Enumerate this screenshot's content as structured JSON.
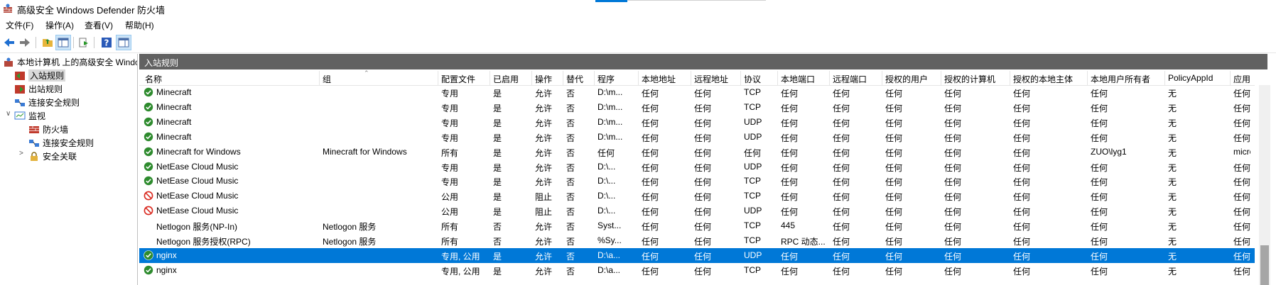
{
  "window": {
    "title": "高级安全 Windows Defender 防火墙"
  },
  "menu": [
    "文件(F)",
    "操作(A)",
    "查看(V)",
    "帮助(H)"
  ],
  "tree": {
    "root": "本地计算机 上的高级安全 Windo",
    "inbound": "入站规则",
    "outbound": "出站规则",
    "consec": "连接安全规则",
    "monitor": "监视",
    "firewall": "防火墙",
    "mon_consec": "连接安全规则",
    "sa": "安全关联"
  },
  "panel": {
    "title": "入站规则"
  },
  "columns": [
    "名称",
    "组",
    "配置文件",
    "已启用",
    "操作",
    "替代",
    "程序",
    "本地地址",
    "远程地址",
    "协议",
    "本地端口",
    "远程端口",
    "授权的用户",
    "授权的计算机",
    "授权的本地主体",
    "本地用户所有者",
    "PolicyAppId",
    "应用程"
  ],
  "rows": [
    {
      "status": "allow",
      "name": "Minecraft",
      "group": "",
      "profile": "专用",
      "enabled": "是",
      "action": "允许",
      "override": "否",
      "program": "D:\\m...",
      "laddr": "任何",
      "raddr": "任何",
      "proto": "TCP",
      "lport": "任何",
      "rport": "任何",
      "users": "任何",
      "computers": "任何",
      "principals": "任何",
      "owner": "任何",
      "policy": "无",
      "app": "任何"
    },
    {
      "status": "allow",
      "name": "Minecraft",
      "group": "",
      "profile": "专用",
      "enabled": "是",
      "action": "允许",
      "override": "否",
      "program": "D:\\m...",
      "laddr": "任何",
      "raddr": "任何",
      "proto": "TCP",
      "lport": "任何",
      "rport": "任何",
      "users": "任何",
      "computers": "任何",
      "principals": "任何",
      "owner": "任何",
      "policy": "无",
      "app": "任何"
    },
    {
      "status": "allow",
      "name": "Minecraft",
      "group": "",
      "profile": "专用",
      "enabled": "是",
      "action": "允许",
      "override": "否",
      "program": "D:\\m...",
      "laddr": "任何",
      "raddr": "任何",
      "proto": "UDP",
      "lport": "任何",
      "rport": "任何",
      "users": "任何",
      "computers": "任何",
      "principals": "任何",
      "owner": "任何",
      "policy": "无",
      "app": "任何"
    },
    {
      "status": "allow",
      "name": "Minecraft",
      "group": "",
      "profile": "专用",
      "enabled": "是",
      "action": "允许",
      "override": "否",
      "program": "D:\\m...",
      "laddr": "任何",
      "raddr": "任何",
      "proto": "UDP",
      "lport": "任何",
      "rport": "任何",
      "users": "任何",
      "computers": "任何",
      "principals": "任何",
      "owner": "任何",
      "policy": "无",
      "app": "任何"
    },
    {
      "status": "allow",
      "name": "Minecraft for Windows",
      "group": "Minecraft for Windows",
      "profile": "所有",
      "enabled": "是",
      "action": "允许",
      "override": "否",
      "program": "任何",
      "laddr": "任何",
      "raddr": "任何",
      "proto": "任何",
      "lport": "任何",
      "rport": "任何",
      "users": "任何",
      "computers": "任何",
      "principals": "任何",
      "owner": "ZUO\\lyg1",
      "policy": "无",
      "app": "micro"
    },
    {
      "status": "allow",
      "name": "NetEase Cloud Music",
      "group": "",
      "profile": "专用",
      "enabled": "是",
      "action": "允许",
      "override": "否",
      "program": "D:\\...",
      "laddr": "任何",
      "raddr": "任何",
      "proto": "UDP",
      "lport": "任何",
      "rport": "任何",
      "users": "任何",
      "computers": "任何",
      "principals": "任何",
      "owner": "任何",
      "policy": "无",
      "app": "任何"
    },
    {
      "status": "allow",
      "name": "NetEase Cloud Music",
      "group": "",
      "profile": "专用",
      "enabled": "是",
      "action": "允许",
      "override": "否",
      "program": "D:\\...",
      "laddr": "任何",
      "raddr": "任何",
      "proto": "TCP",
      "lport": "任何",
      "rport": "任何",
      "users": "任何",
      "computers": "任何",
      "principals": "任何",
      "owner": "任何",
      "policy": "无",
      "app": "任何"
    },
    {
      "status": "block",
      "name": "NetEase Cloud Music",
      "group": "",
      "profile": "公用",
      "enabled": "是",
      "action": "阻止",
      "override": "否",
      "program": "D:\\...",
      "laddr": "任何",
      "raddr": "任何",
      "proto": "TCP",
      "lport": "任何",
      "rport": "任何",
      "users": "任何",
      "computers": "任何",
      "principals": "任何",
      "owner": "任何",
      "policy": "无",
      "app": "任何"
    },
    {
      "status": "block",
      "name": "NetEase Cloud Music",
      "group": "",
      "profile": "公用",
      "enabled": "是",
      "action": "阻止",
      "override": "否",
      "program": "D:\\...",
      "laddr": "任何",
      "raddr": "任何",
      "proto": "UDP",
      "lport": "任何",
      "rport": "任何",
      "users": "任何",
      "computers": "任何",
      "principals": "任何",
      "owner": "任何",
      "policy": "无",
      "app": "任何"
    },
    {
      "status": "none",
      "name": "Netlogon 服务(NP-In)",
      "group": "Netlogon 服务",
      "profile": "所有",
      "enabled": "否",
      "action": "允许",
      "override": "否",
      "program": "Syst...",
      "laddr": "任何",
      "raddr": "任何",
      "proto": "TCP",
      "lport": "445",
      "rport": "任何",
      "users": "任何",
      "computers": "任何",
      "principals": "任何",
      "owner": "任何",
      "policy": "无",
      "app": "任何"
    },
    {
      "status": "none",
      "name": "Netlogon 服务授权(RPC)",
      "group": "Netlogon 服务",
      "profile": "所有",
      "enabled": "否",
      "action": "允许",
      "override": "否",
      "program": "%Sy...",
      "laddr": "任何",
      "raddr": "任何",
      "proto": "TCP",
      "lport": "RPC 动态...",
      "rport": "任何",
      "users": "任何",
      "computers": "任何",
      "principals": "任何",
      "owner": "任何",
      "policy": "无",
      "app": "任何"
    },
    {
      "status": "allow",
      "name": "nginx",
      "group": "",
      "profile": "专用, 公用",
      "enabled": "是",
      "action": "允许",
      "override": "否",
      "program": "D:\\a...",
      "laddr": "任何",
      "raddr": "任何",
      "proto": "UDP",
      "lport": "任何",
      "rport": "任何",
      "users": "任何",
      "computers": "任何",
      "principals": "任何",
      "owner": "任何",
      "policy": "无",
      "app": "任何",
      "selected": true
    },
    {
      "status": "allow",
      "name": "nginx",
      "group": "",
      "profile": "专用, 公用",
      "enabled": "是",
      "action": "允许",
      "override": "否",
      "program": "D:\\a...",
      "laddr": "任何",
      "raddr": "任何",
      "proto": "TCP",
      "lport": "任何",
      "rport": "任何",
      "users": "任何",
      "computers": "任何",
      "principals": "任何",
      "owner": "任何",
      "policy": "无",
      "app": "任何"
    }
  ],
  "colors": {
    "accent": "#0078d7",
    "allow": "#2e8b2e",
    "block": "#d9261c",
    "panel_header": "#616161"
  }
}
